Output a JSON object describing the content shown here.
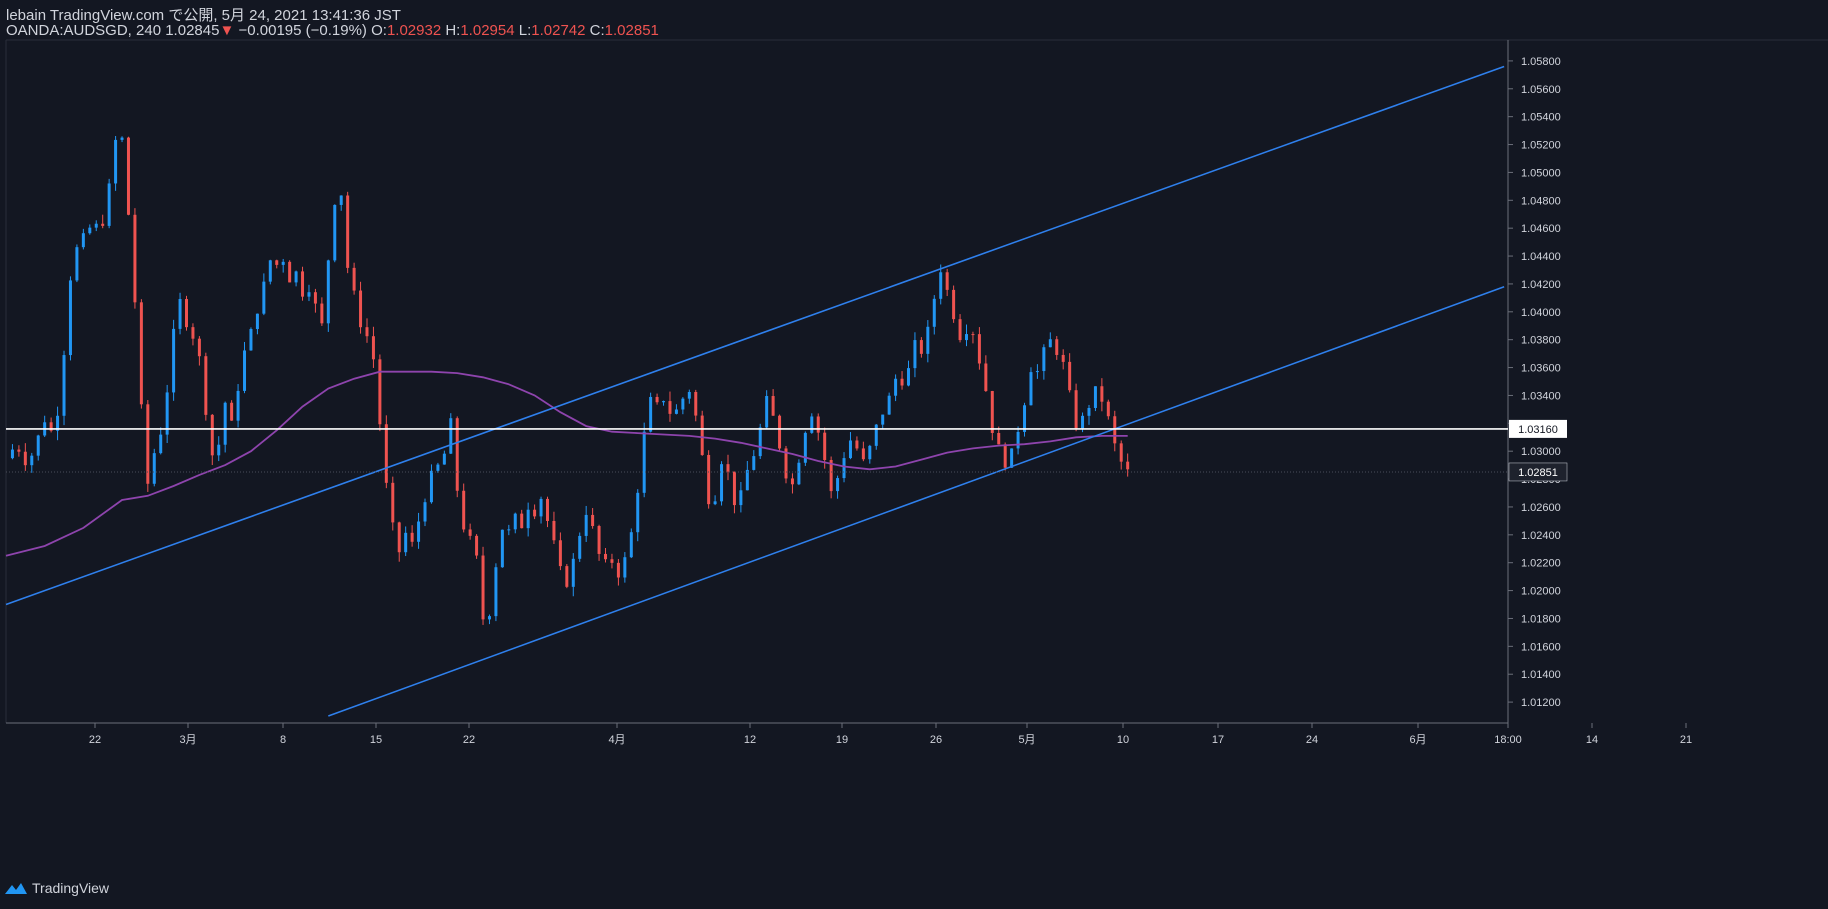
{
  "header": {
    "publish_line": "lebain TradingView.com で公開, 5月 24, 2021 13:41:36 JST",
    "symbol": "OANDA:AUDSGD, 240",
    "last": "1.02845",
    "change_arrow": "▼",
    "change": "−0.00195 (−0.19%)",
    "o_label": "O:",
    "o": "1.02932",
    "h_label": "H:",
    "h": "1.02954",
    "l_label": "L:",
    "l": "1.02742",
    "c_label": "C:",
    "c": "1.02851"
  },
  "footer": {
    "brand": "TradingView",
    "icon": "tradingview-logo-icon"
  },
  "colors": {
    "background": "#131722",
    "up": "#2196f3",
    "down": "#ef5350",
    "ma": "#8e44ad",
    "channel": "#2f80ed",
    "level": "#ffffff"
  },
  "chart_data": {
    "type": "candlestick",
    "symbol": "OANDA:AUDSGD",
    "interval": "240",
    "ylim": [
      1.0105,
      1.0595
    ],
    "y_ticks": [
      "1.05800",
      "1.05600",
      "1.05400",
      "1.05200",
      "1.05000",
      "1.04800",
      "1.04600",
      "1.04400",
      "1.04200",
      "1.04000",
      "1.03800",
      "1.03600",
      "1.03400",
      "1.03200",
      "1.03000",
      "1.02800",
      "1.02600",
      "1.02400",
      "1.02200",
      "1.02000",
      "1.01800",
      "1.01600",
      "1.01400",
      "1.01200"
    ],
    "x_ticks": [
      "22",
      "3月",
      "8",
      "15",
      "22",
      "4月",
      "12",
      "19",
      "26",
      "5月",
      "10",
      "17",
      "24",
      "6月",
      "18:00",
      "14",
      "21"
    ],
    "horizontal_level": {
      "value": 1.0316,
      "label": "1.03160"
    },
    "last_price_label": "1.02851",
    "last_price": 1.02851,
    "price_path": [
      [
        0,
        1.0295
      ],
      [
        0.8,
        1.0305
      ],
      [
        1.7,
        1.029
      ],
      [
        2.5,
        1.031
      ],
      [
        3.2,
        1.0328
      ],
      [
        3.7,
        1.0305
      ],
      [
        4.2,
        1.0345
      ],
      [
        4.7,
        1.039
      ],
      [
        5.0,
        1.0425
      ],
      [
        5.4,
        1.044
      ],
      [
        5.8,
        1.046
      ],
      [
        6.2,
        1.0445
      ],
      [
        6.7,
        1.047
      ],
      [
        7.2,
        1.0455
      ],
      [
        7.8,
        1.0475
      ],
      [
        8.3,
        1.051
      ],
      [
        8.7,
        1.0535
      ],
      [
        9.1,
        1.052
      ],
      [
        9.5,
        1.047
      ],
      [
        9.9,
        1.042
      ],
      [
        10.3,
        1.037
      ],
      [
        10.6,
        1.031
      ],
      [
        10.9,
        1.027
      ],
      [
        11.2,
        1.029
      ],
      [
        11.7,
        1.0305
      ],
      [
        12.2,
        1.032
      ],
      [
        12.7,
        1.036
      ],
      [
        13.2,
        1.04
      ],
      [
        13.7,
        1.0412
      ],
      [
        14.2,
        1.038
      ],
      [
        14.7,
        1.0385
      ],
      [
        15.1,
        1.036
      ],
      [
        15.5,
        1.033
      ],
      [
        15.9,
        1.03
      ],
      [
        16.3,
        1.029
      ],
      [
        16.7,
        1.032
      ],
      [
        17.2,
        1.0345
      ],
      [
        17.6,
        1.031
      ],
      [
        18.1,
        1.0355
      ],
      [
        18.6,
        1.0375
      ],
      [
        19.2,
        1.039
      ],
      [
        19.7,
        1.041
      ],
      [
        20.2,
        1.0425
      ],
      [
        20.7,
        1.0445
      ],
      [
        21.1,
        1.043
      ],
      [
        21.6,
        1.044
      ],
      [
        22.1,
        1.042
      ],
      [
        22.6,
        1.043
      ],
      [
        23.1,
        1.041
      ],
      [
        23.6,
        1.042
      ],
      [
        24.1,
        1.04
      ],
      [
        24.5,
        1.039
      ],
      [
        24.9,
        1.043
      ],
      [
        25.4,
        1.047
      ],
      [
        25.7,
        1.05
      ],
      [
        26.0,
        1.0485
      ],
      [
        26.3,
        1.044
      ],
      [
        26.8,
        1.042
      ],
      [
        27.3,
        1.04
      ],
      [
        27.8,
        1.038
      ],
      [
        28.2,
        1.0385
      ],
      [
        28.6,
        1.036
      ],
      [
        29.0,
        1.032
      ],
      [
        29.3,
        1.029
      ],
      [
        29.7,
        1.026
      ],
      [
        30.1,
        1.024
      ],
      [
        30.6,
        1.0225
      ],
      [
        31.1,
        1.0245
      ],
      [
        31.6,
        1.023
      ],
      [
        32.1,
        1.0255
      ],
      [
        32.6,
        1.027
      ],
      [
        33.1,
        1.0285
      ],
      [
        33.6,
        1.029
      ],
      [
        34.1,
        1.03
      ],
      [
        34.5,
        1.032
      ],
      [
        34.9,
        1.028
      ],
      [
        35.3,
        1.025
      ],
      [
        35.8,
        1.024
      ],
      [
        36.3,
        1.023
      ],
      [
        36.7,
        1.0215
      ],
      [
        37.0,
        1.018
      ],
      [
        37.3,
        1.017
      ],
      [
        37.7,
        1.02
      ],
      [
        38.1,
        1.0225
      ],
      [
        38.6,
        1.025
      ],
      [
        39.1,
        1.024
      ],
      [
        39.6,
        1.0255
      ],
      [
        40.1,
        1.0245
      ],
      [
        40.6,
        1.0265
      ],
      [
        41.1,
        1.0255
      ],
      [
        41.6,
        1.027
      ],
      [
        42.1,
        1.0245
      ],
      [
        42.6,
        1.023
      ],
      [
        43.1,
        1.021
      ],
      [
        43.6,
        1.0205
      ],
      [
        44.1,
        1.0225
      ],
      [
        44.6,
        1.0245
      ],
      [
        45.1,
        1.026
      ],
      [
        45.6,
        1.024
      ],
      [
        46.1,
        1.0222
      ],
      [
        46.6,
        1.0218
      ],
      [
        47.1,
        1.0222
      ],
      [
        47.6,
        1.021
      ],
      [
        48.1,
        1.0225
      ],
      [
        48.6,
        1.0245
      ],
      [
        49.1,
        1.028
      ],
      [
        49.6,
        1.032
      ],
      [
        50.1,
        1.034
      ],
      [
        50.6,
        1.033
      ],
      [
        51.1,
        1.034
      ],
      [
        51.6,
        1.0325
      ],
      [
        52.1,
        1.033
      ],
      [
        52.6,
        1.034
      ],
      [
        53.1,
        1.0345
      ],
      [
        53.6,
        1.032
      ],
      [
        54.1,
        1.029
      ],
      [
        54.6,
        1.026
      ],
      [
        55.1,
        1.027
      ],
      [
        55.6,
        1.03
      ],
      [
        56.1,
        1.028
      ],
      [
        56.6,
        1.026
      ],
      [
        57.1,
        1.027
      ],
      [
        57.6,
        1.029
      ],
      [
        58.1,
        1.03
      ],
      [
        58.6,
        1.032
      ],
      [
        59.1,
        1.034
      ],
      [
        59.6,
        1.032
      ],
      [
        60.1,
        1.03
      ],
      [
        60.6,
        1.028
      ],
      [
        61.1,
        1.0275
      ],
      [
        61.6,
        1.03
      ],
      [
        62.1,
        1.032
      ],
      [
        62.6,
        1.033
      ],
      [
        63.1,
        1.031
      ],
      [
        63.6,
        1.029
      ],
      [
        64.1,
        1.0265
      ],
      [
        64.6,
        1.0285
      ],
      [
        65.1,
        1.03
      ],
      [
        65.6,
        1.031
      ],
      [
        66.1,
        1.03
      ],
      [
        66.6,
        1.029
      ],
      [
        67.1,
        1.0305
      ],
      [
        67.6,
        1.032
      ],
      [
        68.1,
        1.033
      ],
      [
        68.6,
        1.034
      ],
      [
        69.1,
        1.0355
      ],
      [
        69.6,
        1.035
      ],
      [
        70.1,
        1.036
      ],
      [
        70.6,
        1.038
      ],
      [
        71.1,
        1.037
      ],
      [
        71.6,
        1.039
      ],
      [
        72.1,
        1.0415
      ],
      [
        72.6,
        1.0435
      ],
      [
        73.1,
        1.041
      ],
      [
        73.6,
        1.0395
      ],
      [
        74.1,
        1.038
      ],
      [
        74.6,
        1.039
      ],
      [
        75.1,
        1.0385
      ],
      [
        75.6,
        1.036
      ],
      [
        76.1,
        1.034
      ],
      [
        76.6,
        1.031
      ],
      [
        77.1,
        1.03
      ],
      [
        77.6,
        1.029
      ],
      [
        78.1,
        1.03
      ],
      [
        78.6,
        1.032
      ],
      [
        79.1,
        1.034
      ],
      [
        79.6,
        1.0365
      ],
      [
        80.1,
        1.0355
      ],
      [
        80.6,
        1.0375
      ],
      [
        81.1,
        1.038
      ],
      [
        81.6,
        1.037
      ],
      [
        82.1,
        1.036
      ],
      [
        82.6,
        1.0335
      ],
      [
        83.1,
        1.0315
      ],
      [
        83.6,
        1.0325
      ],
      [
        84.1,
        1.0335
      ],
      [
        84.6,
        1.0345
      ],
      [
        85.1,
        1.0335
      ],
      [
        85.6,
        1.032
      ],
      [
        86.1,
        1.03
      ],
      [
        86.6,
        1.029
      ],
      [
        87.0,
        1.0285
      ]
    ],
    "ma_curve": [
      [
        0,
        1.0225
      ],
      [
        3,
        1.0232
      ],
      [
        6,
        1.0245
      ],
      [
        9,
        1.0265
      ],
      [
        11,
        1.0268
      ],
      [
        13,
        1.0275
      ],
      [
        15,
        1.0283
      ],
      [
        17,
        1.029
      ],
      [
        19,
        1.03
      ],
      [
        21,
        1.0315
      ],
      [
        23,
        1.0332
      ],
      [
        25,
        1.0345
      ],
      [
        27,
        1.0352
      ],
      [
        29,
        1.0357
      ],
      [
        31,
        1.0357
      ],
      [
        33,
        1.0357
      ],
      [
        35,
        1.0356
      ],
      [
        37,
        1.0353
      ],
      [
        39,
        1.0348
      ],
      [
        41,
        1.034
      ],
      [
        43,
        1.0328
      ],
      [
        45,
        1.0318
      ],
      [
        47,
        1.0314
      ],
      [
        49,
        1.0313
      ],
      [
        51,
        1.0312
      ],
      [
        53,
        1.0311
      ],
      [
        55,
        1.0309
      ],
      [
        57,
        1.0306
      ],
      [
        59,
        1.0302
      ],
      [
        61,
        1.0298
      ],
      [
        63,
        1.0293
      ],
      [
        65,
        1.0289
      ],
      [
        67,
        1.0287
      ],
      [
        69,
        1.0289
      ],
      [
        71,
        1.0294
      ],
      [
        73,
        1.0299
      ],
      [
        75,
        1.0302
      ],
      [
        77,
        1.0304
      ],
      [
        79,
        1.0305
      ],
      [
        81,
        1.0307
      ],
      [
        83,
        1.031
      ],
      [
        85,
        1.0311
      ],
      [
        87,
        1.0311
      ]
    ],
    "channel_upper": [
      [
        0,
        1.019
      ],
      [
        116.2,
        1.0576
      ]
    ],
    "channel_lower": [
      [
        25,
        1.011
      ],
      [
        116.2,
        1.0418
      ]
    ],
    "x_range": [
      0,
      116.5
    ]
  }
}
